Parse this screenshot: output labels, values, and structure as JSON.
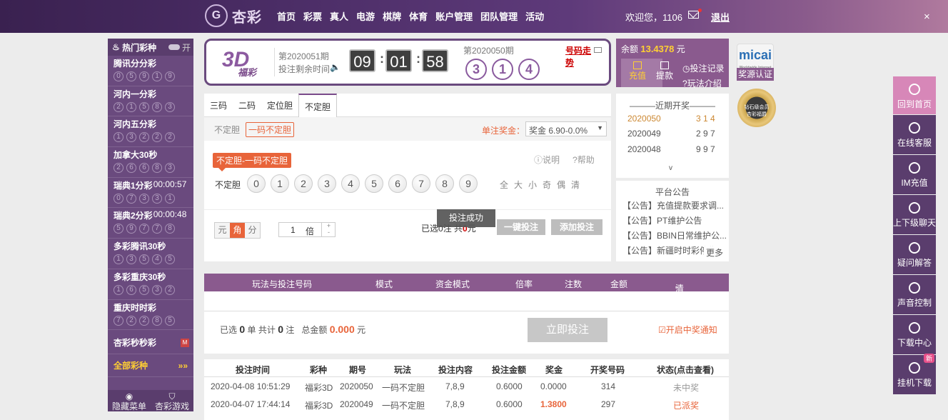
{
  "header": {
    "logo_mark": "G",
    "logo_text": "杏彩",
    "nav": [
      "首页",
      "彩票",
      "真人",
      "电游",
      "棋牌",
      "体育",
      "账户管理",
      "团队管理",
      "活动"
    ],
    "welcome": "欢迎您，1106",
    "logout": "退出",
    "close": "×"
  },
  "sidebar": {
    "title": "热门彩种",
    "toggle": "开",
    "items": [
      {
        "name": "腾讯分分彩",
        "time": "",
        "balls": [
          "0",
          "5",
          "9",
          "1",
          "9"
        ]
      },
      {
        "name": "河内一分彩",
        "time": "",
        "balls": [
          "2",
          "1",
          "5",
          "8",
          "3"
        ]
      },
      {
        "name": "河内五分彩",
        "time": "",
        "balls": [
          "1",
          "3",
          "2",
          "2",
          "2"
        ]
      },
      {
        "name": "加拿大30秒",
        "time": "",
        "balls": [
          "2",
          "6",
          "6",
          "8",
          "3"
        ]
      },
      {
        "name": "瑞典1分彩",
        "time": "00:00:57",
        "balls": [
          "0",
          "7",
          "3",
          "3",
          "1"
        ]
      },
      {
        "name": "瑞典2分彩",
        "time": "00:00:48",
        "balls": [
          "5",
          "9",
          "7",
          "7",
          "8"
        ]
      },
      {
        "name": "多彩腾讯30秒",
        "time": "",
        "balls": [
          "1",
          "3",
          "5",
          "4",
          "5"
        ]
      },
      {
        "name": "多彩重庆30秒",
        "time": "",
        "balls": [
          "1",
          "6",
          "5",
          "3",
          "2"
        ]
      },
      {
        "name": "重庆时时彩",
        "time": "",
        "balls": [
          "7",
          "2",
          "2",
          "8",
          "5"
        ]
      }
    ],
    "single": "杏彩秒秒彩",
    "single_badge": "M",
    "all": "全部彩种",
    "all_arrow": "»»",
    "bottom": [
      "隐藏菜单",
      "杏彩游戏"
    ]
  },
  "lottery": {
    "logo_big": "3D",
    "logo_small": "福彩",
    "period": "第2020051期",
    "remain_label": "投注剩余时间",
    "timer": [
      "09",
      "01",
      "58"
    ],
    "prev_period": "第2020050期",
    "prev_balls": [
      "3",
      "1",
      "4"
    ],
    "trend": "号码走势"
  },
  "balance": {
    "label": "余额",
    "amount": "13.4378",
    "unit": "元",
    "recharge": "充值",
    "withdraw": "提款",
    "records": "投注记录",
    "rules": "玩法介绍"
  },
  "badges": {
    "micai": "micai",
    "micai_sub": "Worldwide Internet",
    "micai_label": "奖源认证",
    "diamond": "钻石级会员",
    "diamond_sub": "杏彩福爵"
  },
  "tabs": [
    "三码",
    "二码",
    "定位胆",
    "不定胆"
  ],
  "subtabs": {
    "a": "不定胆",
    "b": "一码不定胆",
    "prize_label": "单注奖金：",
    "prize_value": "奖金 6.90-0.0%"
  },
  "rule": {
    "label": "不定胆-一码不定胆",
    "explain": "说明",
    "help": "帮助",
    "row_label": "不定胆",
    "numbers": [
      "0",
      "1",
      "2",
      "3",
      "4",
      "5",
      "6",
      "7",
      "8",
      "9"
    ],
    "quick": [
      "全",
      "大",
      "小",
      "奇",
      "偶",
      "清"
    ]
  },
  "bet": {
    "units": [
      "元",
      "角",
      "分"
    ],
    "multiplier": "1",
    "mult_unit": "倍",
    "plus": "+",
    "minus": "-",
    "sel_prefix": "已选",
    "sel_count": "0",
    "sel_mid": "注  共",
    "sel_amount": "0",
    "sel_suffix": "元",
    "toast": "投注成功",
    "quick_bet": "一键投注",
    "add_bet": "添加投注"
  },
  "recent": {
    "title": "近期开奖",
    "rows": [
      {
        "period": "2020050",
        "nums": "3 1 4"
      },
      {
        "period": "2020049",
        "nums": "2 9 7"
      },
      {
        "period": "2020048",
        "nums": "9 9 7"
      }
    ],
    "more": "v"
  },
  "announce": {
    "title": "平台公告",
    "items": [
      "【公告】充值提款要求调...",
      "【公告】PT维护公告",
      "【公告】BBIN日常维护公...",
      "【公告】新疆时时彩停售..."
    ],
    "more": "更多"
  },
  "betlist": {
    "headers": [
      "玩法与投注号码",
      "模式",
      "资金模式",
      "倍率",
      "注数",
      "金额",
      "清空"
    ],
    "sum_a": "已选",
    "sum_b": "0",
    "sum_c": "单 共计",
    "sum_d": "0",
    "sum_e": "注",
    "sum_f": "总金额",
    "sum_amount": "0.000",
    "sum_unit": "元",
    "submit": "立即投注",
    "notify": "开启中奖通知"
  },
  "history": {
    "headers": [
      "投注时间",
      "彩种",
      "期号",
      "玩法",
      "投注内容",
      "投注金额",
      "奖金",
      "开奖号码",
      "状态(点击查看)"
    ],
    "rows": [
      [
        "2020-04-08 10:51:29",
        "福彩3D",
        "2020050",
        "一码不定胆",
        "7,8,9",
        "0.6000",
        "0.0000",
        "314",
        "未中奖"
      ],
      [
        "2020-04-07 17:44:14",
        "福彩3D",
        "2020049",
        "一码不定胆",
        "7,8,9",
        "0.6000",
        "1.3800",
        "297",
        "已派奖"
      ]
    ]
  },
  "floatbar": [
    {
      "label": "回到首页",
      "icon": "home-icon"
    },
    {
      "label": "在线客服",
      "icon": "headset-icon"
    },
    {
      "label": "IM充值",
      "icon": "im-icon"
    },
    {
      "label": "上下级聊天",
      "icon": "chat-icon"
    },
    {
      "label": "疑问解答",
      "icon": "question-icon"
    },
    {
      "label": "声音控制",
      "icon": "speaker-icon"
    },
    {
      "label": "下载中心",
      "icon": "download-icon"
    },
    {
      "label": "挂机下载",
      "icon": "yen-icon",
      "badge": "新"
    }
  ],
  "colors": {
    "purple": "#6a4a7e",
    "orange": "#e8643a",
    "gold": "#ffcf33"
  }
}
